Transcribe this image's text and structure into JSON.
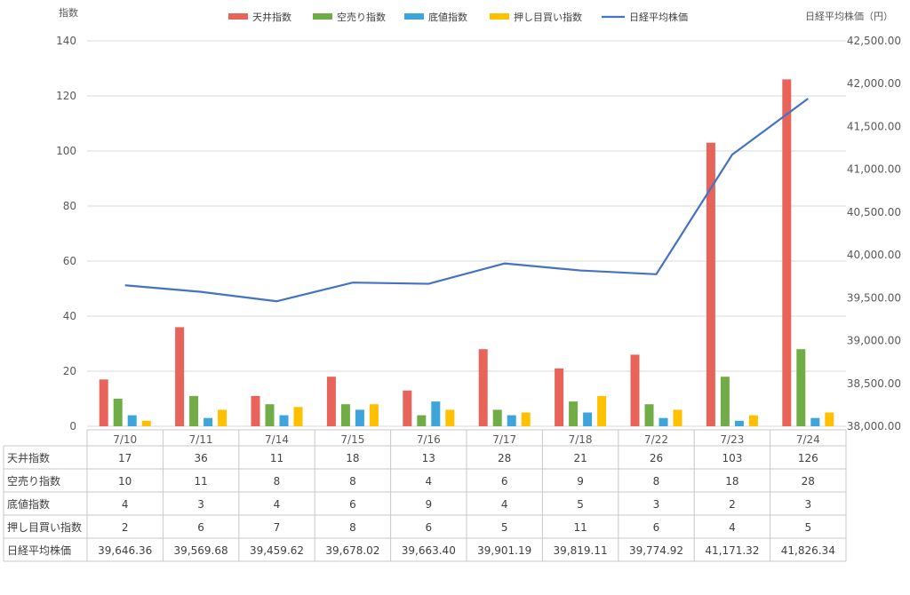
{
  "chart_data": {
    "type": "bar",
    "y_left_label": "指数",
    "y_right_label": "日経平均株価（円）",
    "categories": [
      "7/10",
      "7/11",
      "7/14",
      "7/15",
      "7/16",
      "7/17",
      "7/18",
      "7/22",
      "7/23",
      "7/24"
    ],
    "y_left_ticks": [
      "0",
      "20",
      "40",
      "60",
      "80",
      "100",
      "120",
      "140"
    ],
    "y_left_lim": [
      0,
      140
    ],
    "y_right_ticks": [
      "38,000.00",
      "38,500.00",
      "39,000.00",
      "39,500.00",
      "40,000.00",
      "40,500.00",
      "41,000.00",
      "41,500.00",
      "42,000.00",
      "42,500.00"
    ],
    "y_right_lim": [
      38000,
      42500
    ],
    "grid": true,
    "legend_position": "top",
    "series": [
      {
        "name": "天井指数",
        "type": "bar",
        "axis": "left",
        "color": "#E8635A",
        "values": [
          17,
          36,
          11,
          18,
          13,
          28,
          21,
          26,
          103,
          126
        ],
        "labels": [
          "17",
          "36",
          "11",
          "18",
          "13",
          "28",
          "21",
          "26",
          "103",
          "126"
        ]
      },
      {
        "name": "空売り指数",
        "type": "bar",
        "axis": "left",
        "color": "#70AD47",
        "values": [
          10,
          11,
          8,
          8,
          4,
          6,
          9,
          8,
          18,
          28
        ],
        "labels": [
          "10",
          "11",
          "8",
          "8",
          "4",
          "6",
          "9",
          "8",
          "18",
          "28"
        ]
      },
      {
        "name": "底値指数",
        "type": "bar",
        "axis": "left",
        "color": "#3DA5DA",
        "values": [
          4,
          3,
          4,
          6,
          9,
          4,
          5,
          3,
          2,
          3
        ],
        "labels": [
          "4",
          "3",
          "4",
          "6",
          "9",
          "4",
          "5",
          "3",
          "2",
          "3"
        ]
      },
      {
        "name": "押し目買い指数",
        "type": "bar",
        "axis": "left",
        "color": "#FFC000",
        "values": [
          2,
          6,
          7,
          8,
          6,
          5,
          11,
          6,
          4,
          5
        ],
        "labels": [
          "2",
          "6",
          "7",
          "8",
          "6",
          "5",
          "11",
          "6",
          "4",
          "5"
        ]
      },
      {
        "name": "日経平均株価",
        "type": "line",
        "axis": "right",
        "color": "#4472C4",
        "values": [
          39646.36,
          39569.68,
          39459.62,
          39678.02,
          39663.4,
          39901.19,
          39819.11,
          39774.92,
          41171.32,
          41826.34
        ],
        "labels": [
          "39,646.36",
          "39,569.68",
          "39,459.62",
          "39,678.02",
          "39,663.40",
          "39,901.19",
          "39,819.11",
          "39,774.92",
          "41,171.32",
          "41,826.34"
        ]
      }
    ]
  }
}
